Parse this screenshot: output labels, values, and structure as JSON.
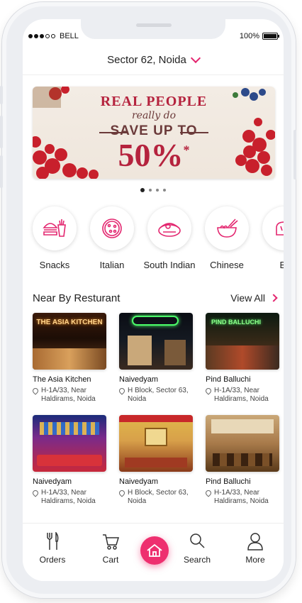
{
  "status_bar": {
    "carrier": "BELL",
    "battery": "100%"
  },
  "header": {
    "location": "Sector 62, Noida"
  },
  "banner": {
    "line1": "REAL PEOPLE",
    "line2": "really do",
    "line3": "SAVE UP TO",
    "line4": "50%",
    "line4_mark": "*",
    "pages": 4,
    "active_page": 1
  },
  "categories": [
    {
      "label": "Snacks",
      "icon": "burger-fries-icon"
    },
    {
      "label": "Italian",
      "icon": "pizza-icon"
    },
    {
      "label": "South Indian",
      "icon": "dosa-icon"
    },
    {
      "label": "Chinese",
      "icon": "noodle-bowl-icon"
    },
    {
      "label": "Br",
      "icon": "bread-icon"
    }
  ],
  "section": {
    "title": "Near By Resturant",
    "view_all": "View All"
  },
  "restaurants": [
    {
      "name": "The Asia Kitchen",
      "addr1": "H-1A/33, Near",
      "addr2": "Haldirams, Noida",
      "sign": "THE ASIA KITCHEN"
    },
    {
      "name": "Naivedyam",
      "addr1": "H Block, Sector 63,",
      "addr2": "Noida",
      "sign": ""
    },
    {
      "name": "Pind Balluchi",
      "addr1": "H-1A/33, Near",
      "addr2": "Haldirams, Noida",
      "sign": "PIND BALLUCHI"
    },
    {
      "name": "Naivedyam",
      "addr1": "H-1A/33, Near",
      "addr2": "Haldirams, Noida",
      "sign": ""
    },
    {
      "name": "Naivedyam",
      "addr1": "H Block, Sector 63,",
      "addr2": "Noida",
      "sign": ""
    },
    {
      "name": "Pind Balluchi",
      "addr1": "H-1A/33, Near",
      "addr2": "Haldirams, Noida",
      "sign": ""
    }
  ],
  "nav": {
    "orders": "Orders",
    "cart": "Cart",
    "search": "Search",
    "more": "More"
  },
  "colors": {
    "accent": "#e3266f",
    "home_button": "#ee2f6f"
  }
}
